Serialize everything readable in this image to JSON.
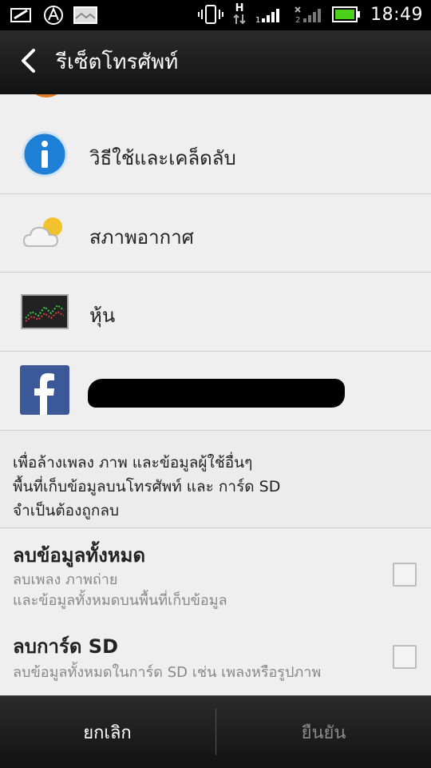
{
  "status_bar": {
    "time": "18:49",
    "network_type": "H",
    "icons": [
      "image-edit-icon",
      "compass-icon",
      "photo-icon",
      "vibrate-icon",
      "data-arrows-icon",
      "signal-icon",
      "battery-icon"
    ]
  },
  "header": {
    "title": "รีเซ็ตโทรศัพท์",
    "back_icon": "chevron-left-icon"
  },
  "list": {
    "items": [
      {
        "label": "วิธีใช้และเคล็ดลับ",
        "icon": "info-icon"
      },
      {
        "label": "สภาพอากาศ",
        "icon": "weather-icon"
      },
      {
        "label": "หุ้น",
        "icon": "stocks-icon"
      },
      {
        "label": "",
        "icon": "facebook-icon"
      }
    ]
  },
  "description": {
    "line1": "เพื่อล้างเพลง ภาพ และข้อมูลผู้ใช้อื่นๆ",
    "line2": "พื้นที่เก็บข้อมูลบนโทรศัพท์ และ การ์ด SD",
    "line3": "จำเป็นต้องถูกลบ"
  },
  "options": {
    "erase_all": {
      "title": "ลบข้อมูลทั้งหมด",
      "sub1": "ลบเพลง ภาพถ่าย",
      "sub2": "และข้อมูลทั้งหมดบนพื้นที่เก็บข้อมูล",
      "checked": false
    },
    "erase_sd": {
      "title": "ลบการ์ด SD",
      "sub1": "ลบข้อมูลทั้งหมดในการ์ด SD เช่น เพลงหรือรูปภาพ",
      "checked": false
    }
  },
  "footer": {
    "cancel_label": "ยกเลิก",
    "confirm_label": "ยืนยัน"
  },
  "colors": {
    "header_bg": "#1c1c1c",
    "content_bg": "#ececec",
    "facebook_blue": "#3b5998",
    "info_blue": "#1e7fd6",
    "battery_green": "#4cd11a",
    "disabled_text": "#8a8a8a"
  }
}
